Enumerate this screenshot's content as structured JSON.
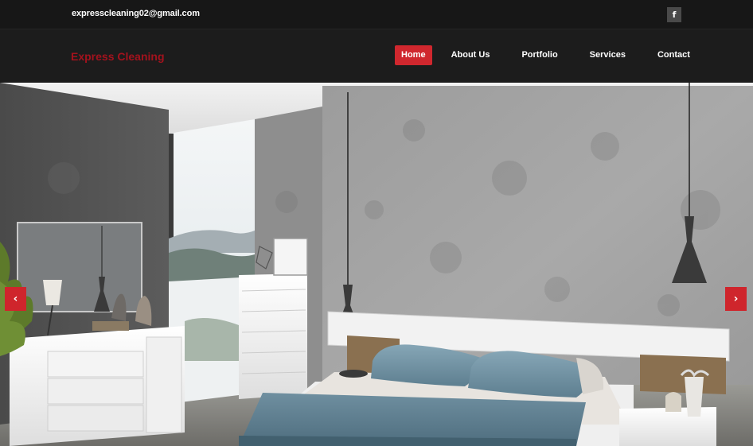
{
  "topbar": {
    "email": "expresscleaning02@gmail.com",
    "facebook_glyph": "f"
  },
  "brand": {
    "name": "Express Cleaning",
    "color": "#a3121d"
  },
  "nav": {
    "active_color": "#d0272e",
    "items": [
      {
        "label": "Home",
        "active": true
      },
      {
        "label": "About Us",
        "active": false
      },
      {
        "label": "Portfolio",
        "active": false
      },
      {
        "label": "Services",
        "active": false
      },
      {
        "label": "Contact",
        "active": false
      }
    ]
  },
  "slider": {
    "image": "modern-bedroom-photo",
    "prev_glyph": "‹",
    "next_glyph": "›"
  }
}
